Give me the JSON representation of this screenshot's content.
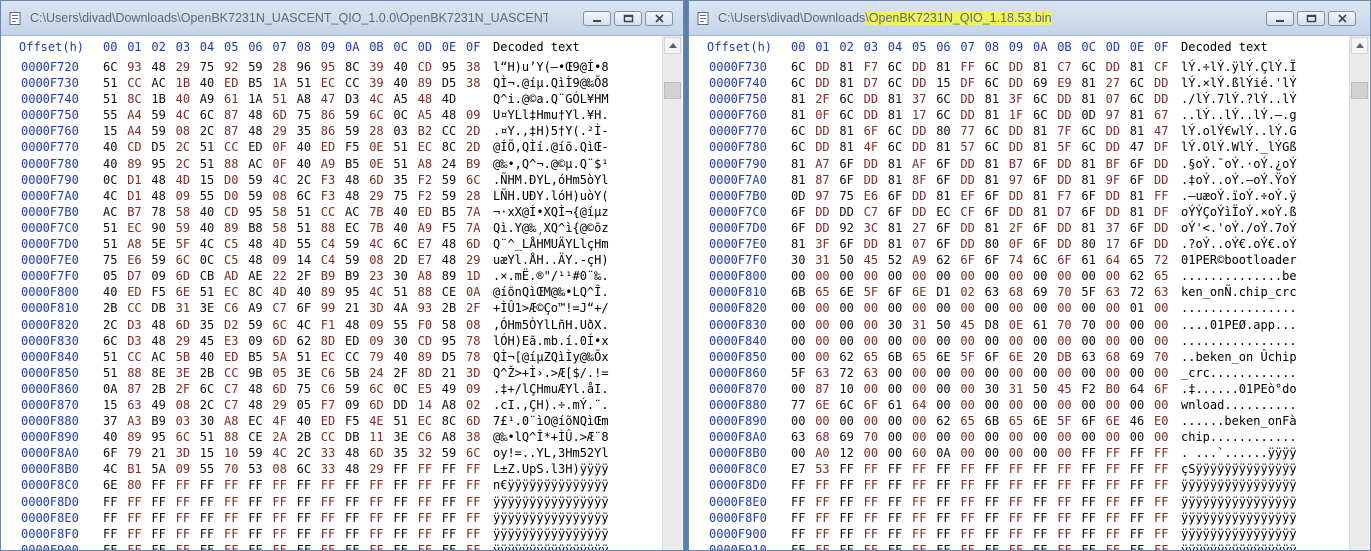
{
  "windows": [
    {
      "title": "C:\\Users\\divad\\Downloads\\OpenBK7231N_UASCENT_QIO_1.0.0\\OpenBK7231N_UASCENT_QIO_1.0.0.b...",
      "title_highlight": "",
      "header": {
        "offset_label": "Offset(h)",
        "columns": [
          "00",
          "01",
          "02",
          "03",
          "04",
          "05",
          "06",
          "07",
          "08",
          "09",
          "0A",
          "0B",
          "0C",
          "0D",
          "0E",
          "0F"
        ],
        "decoded_label": "Decoded text"
      },
      "rows": [
        {
          "offset": "0000F720",
          "bytes": "6C 93 48 29 75 92 59 28 96 95 8C 39 40 CD 95 38",
          "text": "l“H)u’Y(–•Œ9@Í•8"
        },
        {
          "offset": "0000F730",
          "bytes": "51 CC AC 1B 40 ED B5 1A 51 EC CC 39 40 89 D5 38",
          "text": "QÌ¬.@íµ.QìÌ9@‰Õ8"
        },
        {
          "offset": "0000F740",
          "bytes": "51 8C 1B 40 A9 61 1A 51 A8 47 D3 4C A5 48 4D",
          "text": "Q^i.@©a.Q¨GÓL¥HM"
        },
        {
          "offset": "0000F750",
          "bytes": "55 A4 59 4C 6C 87 48 6D 75 86 59 6C 0C A5 48 09",
          "text": "U¤YLl‡Hmu†Yl.¥H."
        },
        {
          "offset": "0000F760",
          "bytes": "15 A4 59 08 2C 87 48 29 35 86 59 28 03 B2 CC 2D",
          "text": ".¤Y.,‡H)5†Y(.²Ì-"
        },
        {
          "offset": "0000F770",
          "bytes": "40 CD D5 2C 51 CC ED 0F 40 ED F5 0E 51 EC 8C 2D",
          "text": "@ÍÕ,QÌí.@íõ.QìŒ-"
        },
        {
          "offset": "0000F780",
          "bytes": "40 89 95 2C 51 88 AC 0F 40 A9 B5 0E 51 A8 24 B9",
          "text": "@‰•,Q^¬.@©µ.Q¨$¹"
        },
        {
          "offset": "0000F790",
          "bytes": "0C D1 48 4D 15 D0 59 4C 2C F3 48 6D 35 F2 59 6C",
          "text": ".ÑHM.ÐYL,óHm5òYl"
        },
        {
          "offset": "0000F7A0",
          "bytes": "4C D1 48 09 55 D0 59 08 6C F3 48 29 75 F2 59 28",
          "text": "LÑH.UÐY.lóH)uòY("
        },
        {
          "offset": "0000F7B0",
          "bytes": "AC B7 78 58 40 CD 95 58 51 CC AC 7B 40 ED B5 7A",
          "text": "¬·xX@Í•XQÌ¬{@íµz"
        },
        {
          "offset": "0000F7C0",
          "bytes": "51 EC 90 59 40 89 B8 58 51 88 EC 7B 40 A9 F5 7A",
          "text": "Qì.Y@‰¸XQ^ì{@©õz"
        },
        {
          "offset": "0000F7D0",
          "bytes": "51 A8 5E 5F 4C C5 48 4D 55 C4 59 4C 6C E7 48 6D",
          "text": "Q¨^_LÅHMUÄYLlçHm"
        },
        {
          "offset": "0000F7E0",
          "bytes": "75 E6 59 6C 0C C5 48 09 14 C4 59 08 2D E7 48 29",
          "text": "uæYl.ÅH..ÄY.-çH)"
        },
        {
          "offset": "0000F7F0",
          "bytes": "05 D7 09 6D CB AD AE 22 2F B9 B9 23 30 A8 89 1D",
          "text": ".×.mË.®\"/¹¹#0¨‰."
        },
        {
          "offset": "0000F800",
          "bytes": "40 ED F5 6E 51 EC 8C 4D 40 89 95 4C 51 88 CE 0A",
          "text": "@íõnQìŒM@‰•LQ^Î."
        },
        {
          "offset": "0000F810",
          "bytes": "2B CC DB 31 3E C6 A9 C7 6F 99 21 3D 4A 93 2B 2F",
          "text": "+ÌÛ1>Æ©Ço™!=J“+/"
        },
        {
          "offset": "0000F820",
          "bytes": "2C D3 48 6D 35 D2 59 6C 4C F1 48 09 55 F0 58 08",
          "text": ",ÓHm5ÒYlLñH.UðX."
        },
        {
          "offset": "0000F830",
          "bytes": "6C D3 48 29 45 E3 09 6D 62 8D ED 09 30 CD 95 78",
          "text": "lÓH)Eã.mb.í.0Í•x"
        },
        {
          "offset": "0000F840",
          "bytes": "51 CC AC 5B 40 ED B5 5A 51 EC CC 79 40 89 D5 78",
          "text": "QÌ¬[@íµZQìÌy@‰Õx"
        },
        {
          "offset": "0000F850",
          "bytes": "51 88 8E 3E 2B CC 9B 05 3E C6 5B 24 2F 8D 21 3D",
          "text": "Q^Ž>+Ì›.>Æ[$/.!="
        },
        {
          "offset": "0000F860",
          "bytes": "0A 87 2B 2F 6C C7 48 6D 75 C6 59 6C 0C E5 49 09",
          "text": ".‡+/lÇHmuÆYl.åI."
        },
        {
          "offset": "0000F870",
          "bytes": "15 63 49 08 2C C7 48 29 05 F7 09 6D DD 14 A8 02",
          "text": ".cI.,ÇH).÷.mÝ.¨."
        },
        {
          "offset": "0000F880",
          "bytes": "37 A3 B9 03 30 A8 EC 4F 40 ED F5 4E 51 EC 8C 6D",
          "text": "7£¹.0¨ìO@íõNQìŒm"
        },
        {
          "offset": "0000F890",
          "bytes": "40 89 95 6C 51 88 CE 2A 2B CC DB 11 3E C6 A8 38",
          "text": "@‰•lQ^Î*+ÌÛ.>Æ¨8"
        },
        {
          "offset": "0000F8A0",
          "bytes": "6F 79 21 3D 15 10 59 4C 2C 33 48 6D 35 32 59 6C",
          "text": "oy!=..YL,3Hm52Yl"
        },
        {
          "offset": "0000F8B0",
          "bytes": "4C B1 5A 09 55 70 53 08 6C 33 48 29 FF FF FF FF",
          "text": "L±Z.UpS.l3H)ÿÿÿÿ"
        },
        {
          "offset": "0000F8C0",
          "bytes": "6E 80 FF FF FF FF FF FF FF FF FF FF FF FF FF FF",
          "text": "n€ÿÿÿÿÿÿÿÿÿÿÿÿÿÿ"
        },
        {
          "offset": "0000F8D0",
          "bytes": "FF FF FF FF FF FF FF FF FF FF FF FF FF FF FF FF",
          "text": "ÿÿÿÿÿÿÿÿÿÿÿÿÿÿÿÿ"
        },
        {
          "offset": "0000F8E0",
          "bytes": "FF FF FF FF FF FF FF FF FF FF FF FF FF FF FF FF",
          "text": "ÿÿÿÿÿÿÿÿÿÿÿÿÿÿÿÿ"
        },
        {
          "offset": "0000F8F0",
          "bytes": "FF FF FF FF FF FF FF FF FF FF FF FF FF FF FF FF",
          "text": "ÿÿÿÿÿÿÿÿÿÿÿÿÿÿÿÿ"
        },
        {
          "offset": "0000F900",
          "bytes": "FF FF FF FF FF FF FF FF FF FF FF FF FF FF FF FF",
          "text": "ÿÿÿÿÿÿÿÿÿÿÿÿÿÿÿÿ"
        }
      ]
    },
    {
      "title": "C:\\Users\\divad\\Downloads",
      "title_highlight": "\\OpenBK7231N_QIO_1.18.53.bin",
      "header": {
        "offset_label": "Offset(h)",
        "columns": [
          "00",
          "01",
          "02",
          "03",
          "04",
          "05",
          "06",
          "07",
          "08",
          "09",
          "0A",
          "0B",
          "0C",
          "0D",
          "0E",
          "0F"
        ],
        "decoded_label": "Decoded text"
      },
      "rows": [
        {
          "offset": "0000F730",
          "bytes": "6C DD 81 F7 6C DD 81 FF 6C DD 81 C7 6C DD 81 CF",
          "text": "lÝ.÷lÝ.ÿlÝ.ÇlÝ.Ï"
        },
        {
          "offset": "0000F740",
          "bytes": "6C DD 81 D7 6C DD 15 DF 6C DD 69 E9 81 27 6C DD",
          "text": "lÝ.×lÝ.ßlÝié.'lÝ"
        },
        {
          "offset": "0000F750",
          "bytes": "81 2F 6C DD 81 37 6C DD 81 3F 6C DD 81 07 6C DD",
          "text": "./lÝ.7lÝ.?lÝ..lÝ"
        },
        {
          "offset": "0000F760",
          "bytes": "81 0F 6C DD 81 17 6C DD 81 1F 6C DD 0D 97 81 67",
          "text": "..lÝ..lÝ..lÝ.—.g"
        },
        {
          "offset": "0000F770",
          "bytes": "6C DD 81 6F 6C DD 80 77 6C DD 81 7F 6C DD 81 47",
          "text": "lÝ.olÝ€wlÝ..lÝ.G"
        },
        {
          "offset": "0000F780",
          "bytes": "6C DD 81 4F 6C DD 81 57 6C DD 81 5F 6C DD 47 DF",
          "text": "lÝ.OlÝ.WlÝ._lÝGß"
        },
        {
          "offset": "0000F790",
          "bytes": "81 A7 6F DD 81 AF 6F DD 81 B7 6F DD 81 BF 6F DD",
          "text": ".§oÝ.¯oÝ.·oÝ.¿oÝ"
        },
        {
          "offset": "0000F7A0",
          "bytes": "81 87 6F DD 81 8F 6F DD 81 97 6F DD 81 9F 6F DD",
          "text": ".‡oÝ..oÝ.—oÝ.ŸoÝ"
        },
        {
          "offset": "0000F7B0",
          "bytes": "0D 97 75 E6 6F DD 81 EF 6F DD 81 F7 6F DD 81 FF",
          "text": ".—uæoÝ.ïoÝ.÷oÝ.ÿ"
        },
        {
          "offset": "0000F7C0",
          "bytes": "6F DD DD C7 6F DD EC CF 6F DD 81 D7 6F DD 81 DF",
          "text": "oÝÝÇoÝìÏoÝ.×oÝ.ß"
        },
        {
          "offset": "0000F7D0",
          "bytes": "6F DD 92 3C 81 27 6F DD 81 2F 6F DD 81 37 6F DD",
          "text": "oÝ'<.'oÝ./oÝ.7oÝ"
        },
        {
          "offset": "0000F7E0",
          "bytes": "81 3F 6F DD 81 07 6F DD 80 0F 6F DD 80 17 6F DD",
          "text": ".?oÝ..oÝ€.oÝ€.oÝ"
        },
        {
          "offset": "0000F7F0",
          "bytes": "30 31 50 45 52 A9 62 6F 6F 74 6C 6F 61 64 65 72",
          "text": "01PER©bootloader"
        },
        {
          "offset": "0000F800",
          "bytes": "00 00 00 00 00 00 00 00 00 00 00 00 00 00 62 65",
          "text": "..............be"
        },
        {
          "offset": "0000F810",
          "bytes": "6B 65 6E 5F 6F 6E D1 02 63 68 69 70 5F 63 72 63",
          "text": "ken_onÑ.chip_crc"
        },
        {
          "offset": "0000F820",
          "bytes": "00 00 00 00 00 00 00 00 00 00 00 00 00 00 01 00",
          "text": "................"
        },
        {
          "offset": "0000F830",
          "bytes": "00 00 00 00 30 31 50 45 D8 0E 61 70 70 00 00 00",
          "text": "....01PEØ.app..."
        },
        {
          "offset": "0000F840",
          "bytes": "00 00 00 00 00 00 00 00 00 00 00 00 00 00 00 00",
          "text": "................"
        },
        {
          "offset": "0000F850",
          "bytes": "00 00 62 65 6B 65 6E 5F 6F 6E 20 DB 63 68 69 70",
          "text": "..beken_on Ûchip"
        },
        {
          "offset": "0000F860",
          "bytes": "5F 63 72 63 00 00 00 00 00 00 00 00 00 00 00 00",
          "text": "_crc............"
        },
        {
          "offset": "0000F870",
          "bytes": "00 87 10 00 00 00 00 00 30 31 50 45 F2 B0 64 6F",
          "text": ".‡......01PEò°do"
        },
        {
          "offset": "0000F880",
          "bytes": "77 6E 6C 6F 61 64 00 00 00 00 00 00 00 00 00 00",
          "text": "wnload.........."
        },
        {
          "offset": "0000F890",
          "bytes": "00 00 00 00 00 00 62 65 6B 65 6E 5F 6F 6E 46 E0",
          "text": "......beken_onFà"
        },
        {
          "offset": "0000F8A0",
          "bytes": "63 68 69 70 00 00 00 00 00 00 00 00 00 00 00 00",
          "text": "chip............"
        },
        {
          "offset": "0000F8B0",
          "bytes": "00 A0 12 00 00 60 0A 00 00 00 00 00 FF FF FF FF",
          "text": ". ...`......ÿÿÿÿ"
        },
        {
          "offset": "0000F8C0",
          "bytes": "E7 53 FF FF FF FF FF FF FF FF FF FF FF FF FF FF",
          "text": "çSÿÿÿÿÿÿÿÿÿÿÿÿÿÿ"
        },
        {
          "offset": "0000F8D0",
          "bytes": "FF FF FF FF FF FF FF FF FF FF FF FF FF FF FF FF",
          "text": "ÿÿÿÿÿÿÿÿÿÿÿÿÿÿÿÿ"
        },
        {
          "offset": "0000F8E0",
          "bytes": "FF FF FF FF FF FF FF FF FF FF FF FF FF FF FF FF",
          "text": "ÿÿÿÿÿÿÿÿÿÿÿÿÿÿÿÿ"
        },
        {
          "offset": "0000F8F0",
          "bytes": "FF FF FF FF FF FF FF FF FF FF FF FF FF FF FF FF",
          "text": "ÿÿÿÿÿÿÿÿÿÿÿÿÿÿÿÿ"
        },
        {
          "offset": "0000F900",
          "bytes": "FF FF FF FF FF FF FF FF FF FF FF FF FF FF FF FF",
          "text": "ÿÿÿÿÿÿÿÿÿÿÿÿÿÿÿÿ"
        },
        {
          "offset": "0000F910",
          "bytes": "FF FF FF FF FF FF FF FF FF FF FF FF FF FF FF FF",
          "text": "ÿÿÿÿÿÿÿÿÿÿÿÿÿÿÿÿ"
        }
      ]
    }
  ],
  "colors": {
    "offset": "#1e3ca8",
    "byte_a": "#111111",
    "byte_b": "#7a2c2c",
    "highlight": "#eef35e"
  },
  "icons": {
    "window": "document-icon",
    "minimize": "minimize-icon",
    "maximize": "maximize-icon",
    "close": "close-icon",
    "scroll_up": "scroll-up-arrow-icon"
  }
}
